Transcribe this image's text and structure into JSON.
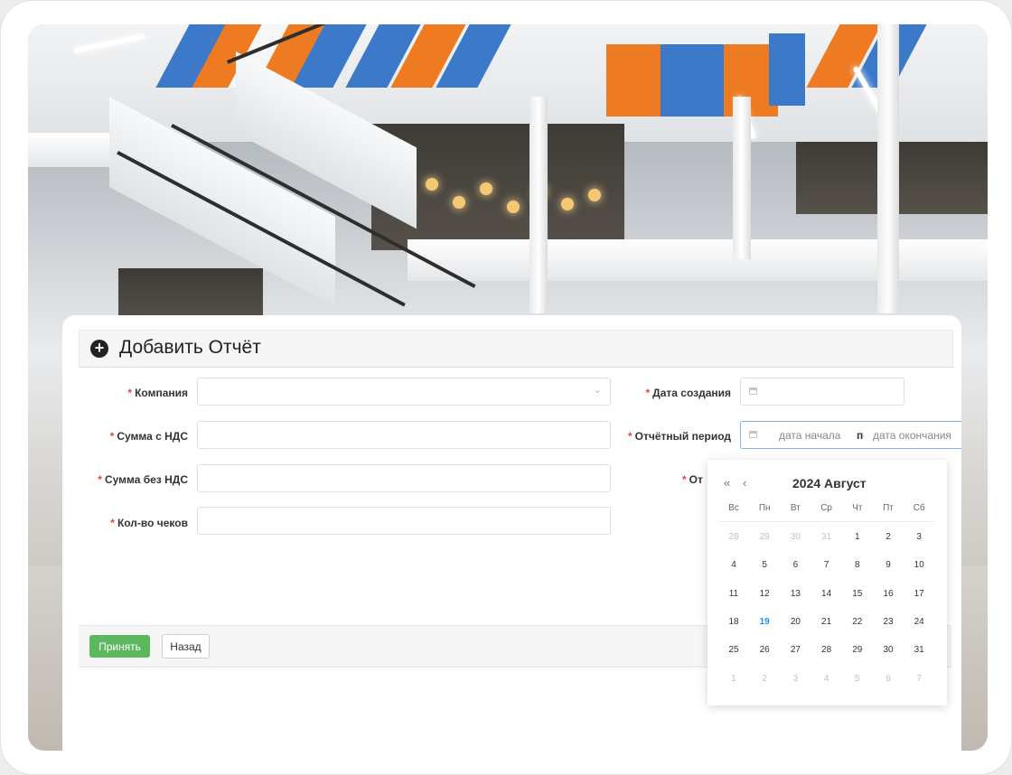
{
  "header": {
    "title": "Добавить Отчёт",
    "icon": "plus-circle-icon"
  },
  "form": {
    "company": {
      "label": "Компания",
      "value": ""
    },
    "sum_vat": {
      "label": "Сумма с НДС",
      "value": ""
    },
    "sum_no_vat": {
      "label": "Сумма без НДС",
      "value": ""
    },
    "checks_count": {
      "label": "Кол-во чеков",
      "value": ""
    },
    "created_date": {
      "label": "Дата создания",
      "value": ""
    },
    "report_period": {
      "label": "Отчётный период",
      "start_placeholder": "дата начала",
      "separator": "по",
      "end_placeholder": "дата окончания"
    },
    "hidden_field": {
      "label": "От"
    },
    "required_mark": "*"
  },
  "buttons": {
    "submit": "Принять",
    "back": "Назад"
  },
  "datepicker": {
    "year": 2024,
    "title": "2024 Август",
    "prev_year": "«",
    "prev_month": "‹",
    "weekdays": [
      "Вс",
      "Пн",
      "Вт",
      "Ср",
      "Чт",
      "Пт",
      "Сб"
    ],
    "weeks": [
      [
        28,
        29,
        30,
        31,
        1,
        2,
        3
      ],
      [
        4,
        5,
        6,
        7,
        8,
        9,
        10
      ],
      [
        11,
        12,
        13,
        14,
        15,
        16,
        17
      ],
      [
        18,
        19,
        20,
        21,
        22,
        23,
        24
      ],
      [
        25,
        26,
        27,
        28,
        29,
        30,
        31
      ],
      [
        1,
        2,
        3,
        4,
        5,
        6,
        7
      ]
    ],
    "today": 19,
    "colors": {
      "today": "#1890ff",
      "submit": "#5cb85c",
      "required": "#e5473b"
    }
  }
}
